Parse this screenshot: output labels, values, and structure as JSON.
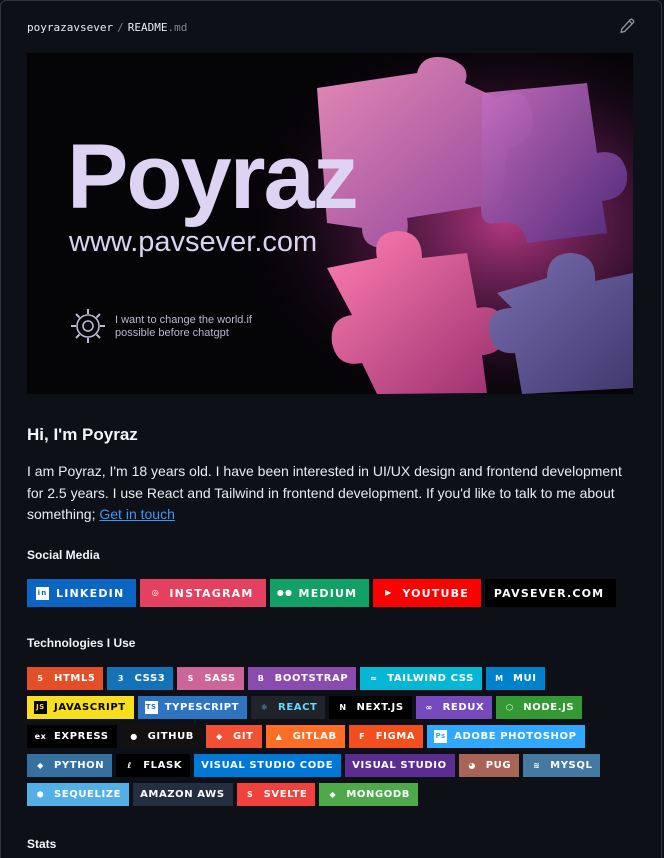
{
  "header": {
    "owner": "poyrazavsever",
    "separator": "/",
    "file": "README",
    "ext": ".md"
  },
  "banner": {
    "title": "Poyraz",
    "url": "www.pavsever.com",
    "tagline_1": "I want to change the world.if",
    "tagline_2": "possible before chatgpt"
  },
  "intro": {
    "heading": "Hi, I'm Poyraz",
    "text": "I am Poyraz, I'm 18 years old. I have been interested in UI/UX design and frontend development for 2.5 years. I use React and Tailwind in frontend development. If you'd like to talk to me about something; ",
    "link": "Get in touch"
  },
  "social": {
    "heading": "Social Media",
    "badges": [
      {
        "label": "LINKEDIN",
        "color": "#0a66c2",
        "icon": "linkedin-icon"
      },
      {
        "label": "INSTAGRAM",
        "color": "#e4405f",
        "icon": "instagram-icon"
      },
      {
        "label": "MEDIUM",
        "color": "#12a164",
        "icon": "medium-icon"
      },
      {
        "label": "YOUTUBE",
        "color": "#ff0000",
        "icon": "youtube-icon"
      },
      {
        "label": "PAVSEVER.COM",
        "color": "#000000",
        "icon": ""
      }
    ]
  },
  "tech": {
    "heading": "Technologies I Use",
    "rows": [
      [
        {
          "label": "HTML5",
          "color": "#e34f26",
          "icon": "html5-icon"
        },
        {
          "label": "CSS3",
          "color": "#1572b6",
          "icon": "css3-icon"
        },
        {
          "label": "SASS",
          "color": "#cc6699",
          "icon": "sass-icon"
        },
        {
          "label": "BOOTSTRAP",
          "color": "#8a4baf",
          "icon": "bootstrap-icon"
        },
        {
          "label": "TAILWIND CSS",
          "color": "#06b6d4",
          "icon": "tailwind-icon"
        },
        {
          "label": "MUI",
          "color": "#0081cb",
          "icon": "mui-icon"
        }
      ],
      [
        {
          "label": "JAVASCRIPT",
          "color": "#f7df1e",
          "icon": "javascript-icon",
          "text": "#000000"
        },
        {
          "label": "TYPESCRIPT",
          "color": "#2f74c0",
          "icon": "typescript-icon"
        },
        {
          "label": "REACT",
          "color": "#61dafb",
          "icon": "react-icon",
          "text": "#20232a",
          "bg": "#20232a"
        },
        {
          "label": "NEXT.JS",
          "color": "#000000",
          "icon": "nextjs-icon"
        },
        {
          "label": "REDUX",
          "color": "#764abc",
          "icon": "redux-icon"
        },
        {
          "label": "NODE.JS",
          "color": "#339933",
          "icon": "nodejs-icon"
        }
      ],
      [
        {
          "label": "EXPRESS",
          "color": "#000000",
          "icon": "express-icon"
        },
        {
          "label": "GITHUB",
          "color": "#121011",
          "icon": "github-icon"
        },
        {
          "label": "GIT",
          "color": "#f05033",
          "icon": "git-icon"
        },
        {
          "label": "GITLAB",
          "color": "#fca121",
          "icon": "gitlab-icon",
          "bg": "#fc6d26"
        },
        {
          "label": "FIGMA",
          "color": "#f24e1e",
          "icon": "figma-icon"
        },
        {
          "label": "ADOBE PHOTOSHOP",
          "color": "#31a8ff",
          "icon": "photoshop-icon"
        }
      ],
      [
        {
          "label": "PYTHON",
          "color": "#3670a0",
          "icon": "python-icon"
        },
        {
          "label": "FLASK",
          "color": "#000000",
          "icon": "flask-icon"
        },
        {
          "label": "VISUAL STUDIO CODE",
          "color": "#0078d7",
          "icon": ""
        },
        {
          "label": "VISUAL STUDIO",
          "color": "#5c2d91",
          "icon": ""
        },
        {
          "label": "PUG",
          "color": "#a86454",
          "icon": "pug-icon"
        },
        {
          "label": "MYSQL",
          "color": "#4479a1",
          "icon": "mysql-icon"
        }
      ],
      [
        {
          "label": "SEQUELIZE",
          "color": "#52b0e7",
          "icon": "sequelize-icon"
        },
        {
          "label": "AMAZON AWS",
          "color": "#232f3e",
          "icon": ""
        },
        {
          "label": "SVELTE",
          "color": "#f1413d",
          "icon": "svelte-icon"
        },
        {
          "label": "MONGODB",
          "color": "#4ea94b",
          "icon": "mongodb-icon"
        }
      ]
    ]
  },
  "stats": {
    "heading": "Stats"
  }
}
